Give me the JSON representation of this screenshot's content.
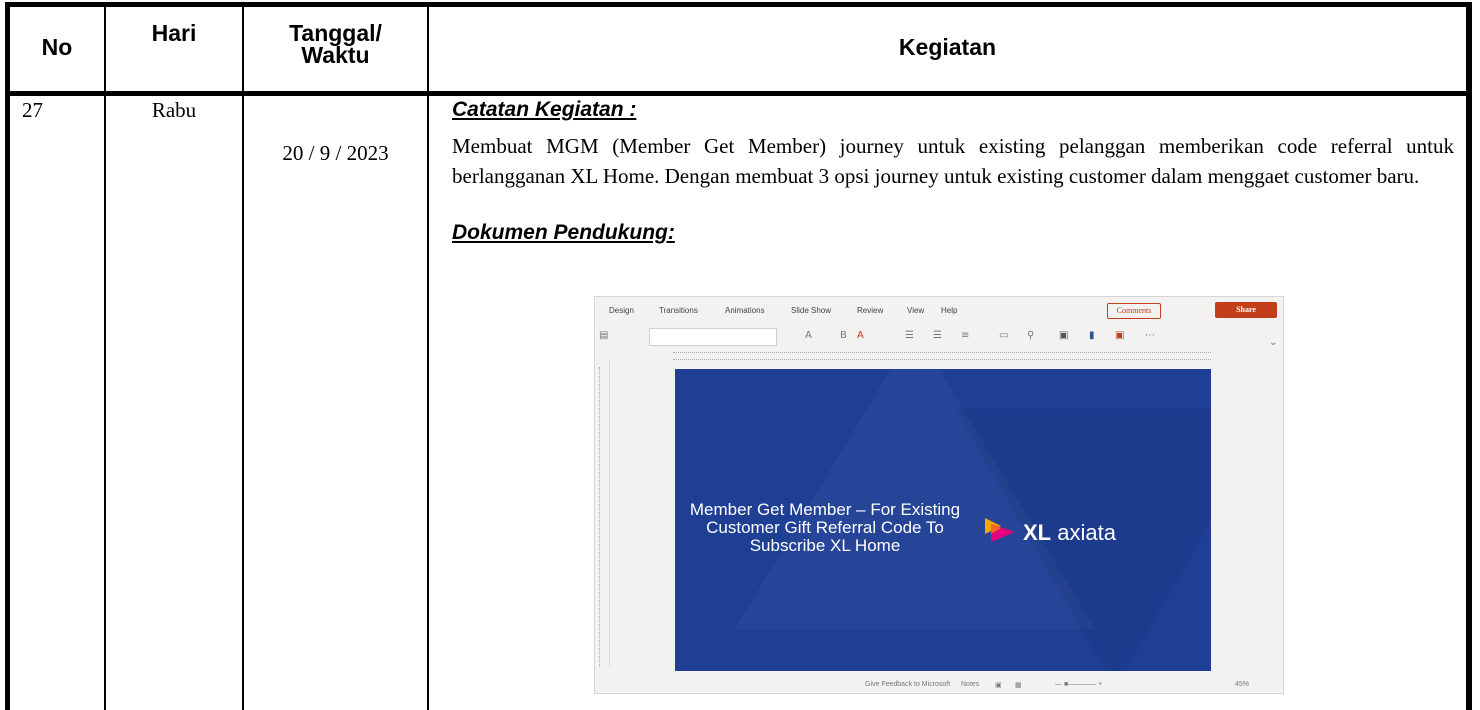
{
  "table": {
    "headers": {
      "no": "No",
      "hari": "Hari",
      "tanggal": "Tanggal/\nWaktu",
      "kegiatan": "Kegiatan"
    },
    "row": {
      "no": "27",
      "hari": "Rabu",
      "tanggal": "20 / 9 / 2023",
      "kegiatan_title": "Catatan Kegiatan :",
      "kegiatan_body": "Membuat MGM (Member Get Member) journey untuk existing pelanggan memberikan code referral untuk berlangganan XL Home. Dengan membuat 3 opsi journey untuk existing customer dalam menggaet customer baru.",
      "dokumen_title": "Dokumen Pendukung:"
    }
  },
  "screenshot": {
    "tabs": [
      "Design",
      "Transitions",
      "Animations",
      "Slide Show",
      "Review",
      "View",
      "Help"
    ],
    "comments_label": "Comments",
    "share_label": "Share",
    "slide_text": "Member Get Member  – For Existing Customer Gift Referral Code To Subscribe XL Home",
    "logo_text": {
      "bold": "XL",
      "rest": "axiata"
    },
    "status_feedback": "Give Feedback to Microsoft",
    "status_notes": "Notes",
    "status_zoom": "45%",
    "slide_color": "#1f3f95",
    "accent_color": "#c43e1c"
  }
}
